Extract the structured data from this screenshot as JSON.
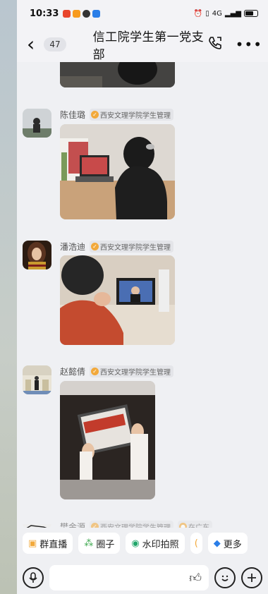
{
  "status_bar": {
    "time": "10:33",
    "network": "4G"
  },
  "header": {
    "back_count": "47",
    "title": "信工院学生第一党支部",
    "more": "•••"
  },
  "messages": [
    {
      "sender": "陈佳璐",
      "badge": "西安文理学院学生管理"
    },
    {
      "sender": "潘浩迪",
      "badge": "西安文理学院学生管理"
    },
    {
      "sender": "赵懿倩",
      "badge": "西安文理学院学生管理"
    },
    {
      "sender": "樊金源",
      "badge": "西安文理学院学生管理",
      "extra": "在广东"
    }
  ],
  "features": [
    {
      "icon": "live-tv-icon",
      "label": "群直播"
    },
    {
      "icon": "circle-icon",
      "label": "圈子"
    },
    {
      "icon": "camera-icon",
      "label": "水印拍照"
    },
    {
      "icon": "more-app-icon",
      "label": "更多"
    }
  ],
  "colors": {
    "accent_orange": "#f2a93b",
    "background": "#eff0f3"
  }
}
